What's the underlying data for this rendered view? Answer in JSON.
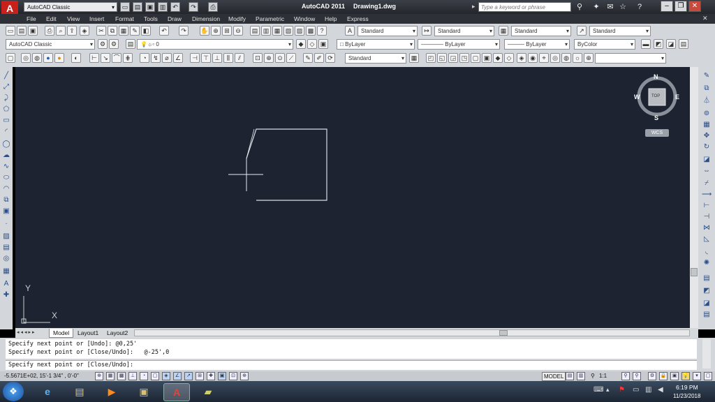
{
  "titlebar": {
    "workspace": "AutoCAD Classic",
    "app_name": "AutoCAD 2011",
    "document": "Drawing1.dwg",
    "search_placeholder": "Type a keyword or phrase"
  },
  "menu": [
    "File",
    "Edit",
    "View",
    "Insert",
    "Format",
    "Tools",
    "Draw",
    "Dimension",
    "Modify",
    "Parametric",
    "Window",
    "Help",
    "Express"
  ],
  "toolbar": {
    "text_style": "Standard",
    "dim_style": "Standard",
    "table_style": "Standard",
    "multileader_style": "Standard",
    "workspace": "AutoCAD Classic",
    "layer": "0",
    "color": "ByLayer",
    "linetype": "ByLayer",
    "lineweight": "ByLayer",
    "plot_style": "ByColor",
    "visual_style": "Standard"
  },
  "viewcube": {
    "north": "N",
    "south": "S",
    "east": "E",
    "west": "W",
    "face": "TOP",
    "ucs": "WCS"
  },
  "ucs_icon": {
    "x": "X",
    "y": "Y"
  },
  "tabs": [
    "Model",
    "Layout1",
    "Layout2"
  ],
  "command": {
    "history": [
      "Specify next point or [Undo]: @0,25'",
      "Specify next point or [Close/Undo]:   @-25',0"
    ],
    "prompt": "Specify next point or [Close/Undo]:"
  },
  "status": {
    "coords": "-5.5671E+02, 15'-1 3/4\" , 0'-0\"",
    "space": "MODEL",
    "scale": "1:1"
  },
  "taskbar": {
    "time": "6:19 PM",
    "date": "11/23/2018"
  }
}
